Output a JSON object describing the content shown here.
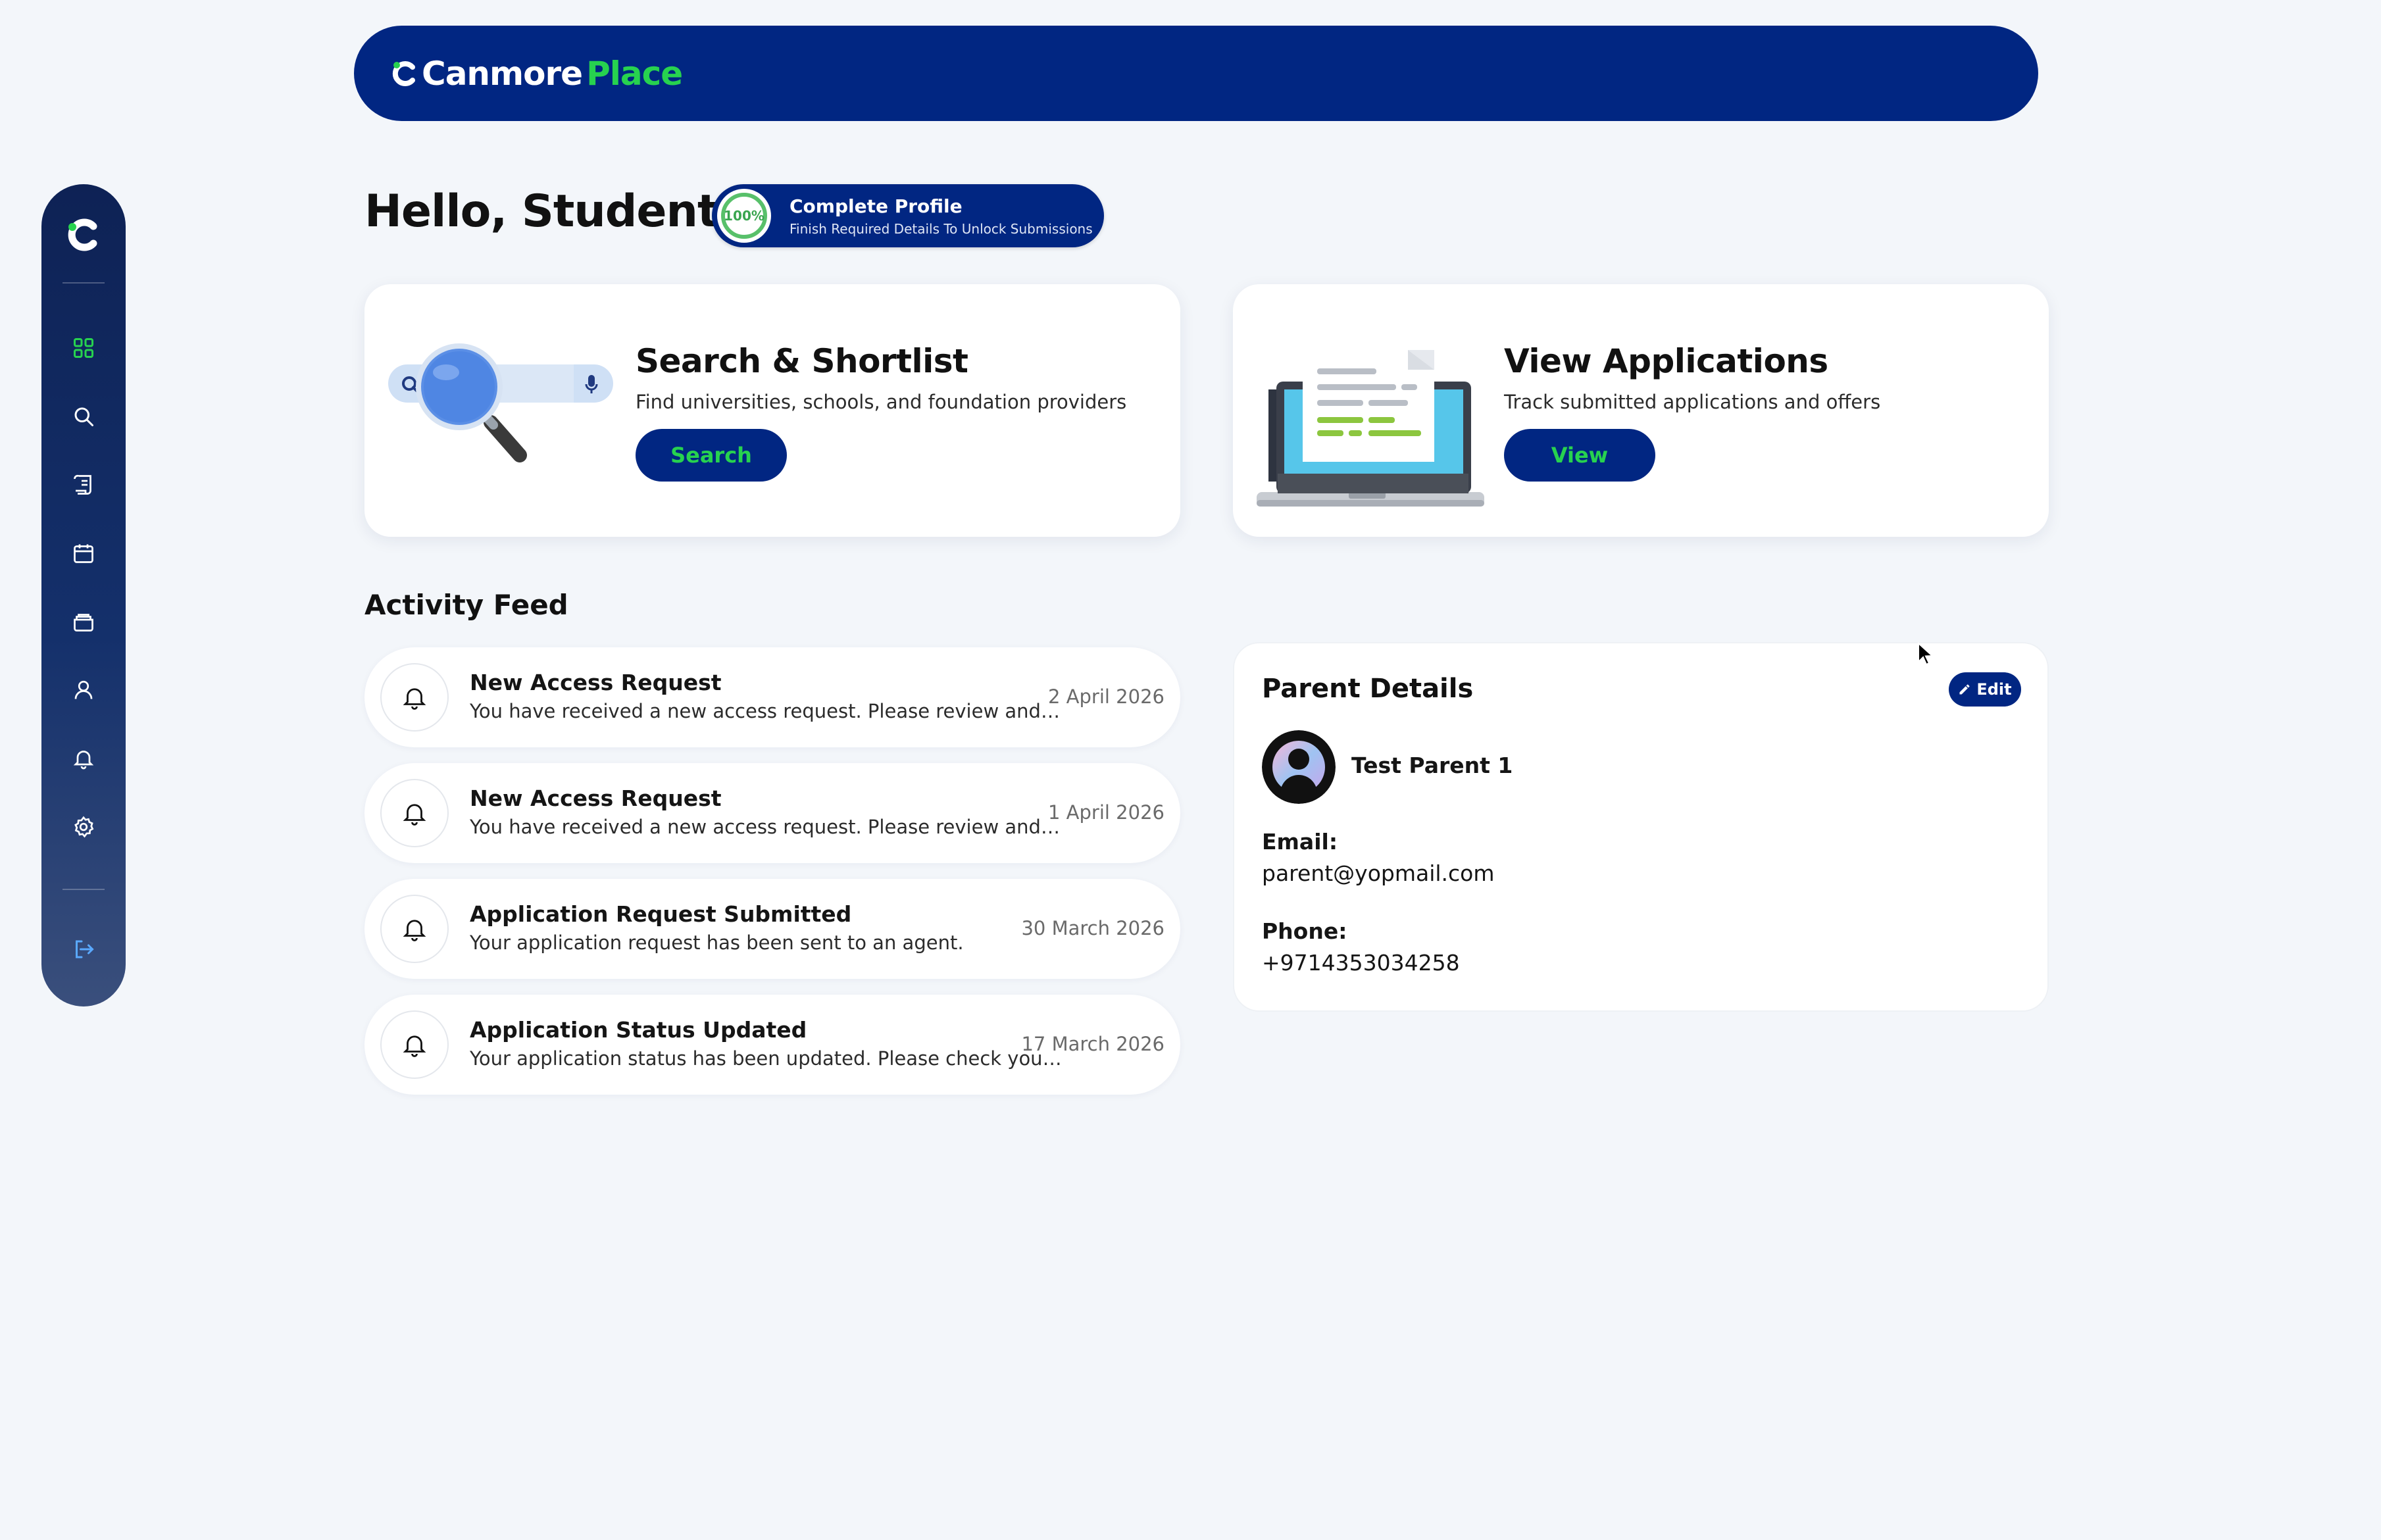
{
  "brand": {
    "name_part1": "Canmore",
    "name_part2": "Place"
  },
  "sidebar": {
    "items": [
      {
        "icon": "dashboard-grid-icon",
        "active": true
      },
      {
        "icon": "search-icon"
      },
      {
        "icon": "scroll-document-icon"
      },
      {
        "icon": "calendar-icon"
      },
      {
        "icon": "folder-icon"
      },
      {
        "icon": "user-icon"
      },
      {
        "icon": "bell-icon"
      },
      {
        "icon": "gear-icon"
      }
    ],
    "logout_icon": "logout-icon",
    "active_color": "#27d24f"
  },
  "greeting": "Hello, Student1",
  "profile": {
    "percent": "100%",
    "title": "Complete Profile",
    "subtitle": "Finish Required Details To Unlock Submissions"
  },
  "cards": {
    "search": {
      "title": "Search & Shortlist",
      "description": "Find universities, schools, and foundation providers",
      "button": "Search"
    },
    "applications": {
      "title": "View Applications",
      "description": "Track submitted applications and offers",
      "button": "View"
    }
  },
  "activity": {
    "heading": "Activity Feed",
    "items": [
      {
        "title": "New Access Request",
        "message": "You have received a new access request. Please review and take action.",
        "date": "2 April 2026"
      },
      {
        "title": "New Access Request",
        "message": "You have received a new access request. Please review and take action.",
        "date": "1 April 2026"
      },
      {
        "title": "Application Request Submitted",
        "message": "Your application request has been sent to an agent.",
        "date": "30 March 2026"
      },
      {
        "title": "Application Status Updated",
        "message": "Your application status has been updated. Please check your application.",
        "date": "17 March 2026"
      }
    ]
  },
  "parent": {
    "heading": "Parent Details",
    "edit_label": "Edit",
    "name": "Test Parent 1",
    "email_label": "Email:",
    "email": "parent@yopmail.com",
    "phone_label": "Phone:",
    "phone": "+9714353034258"
  },
  "colors": {
    "primary": "#012682",
    "accent_green": "#27d24f",
    "background": "#f3f6fa"
  }
}
